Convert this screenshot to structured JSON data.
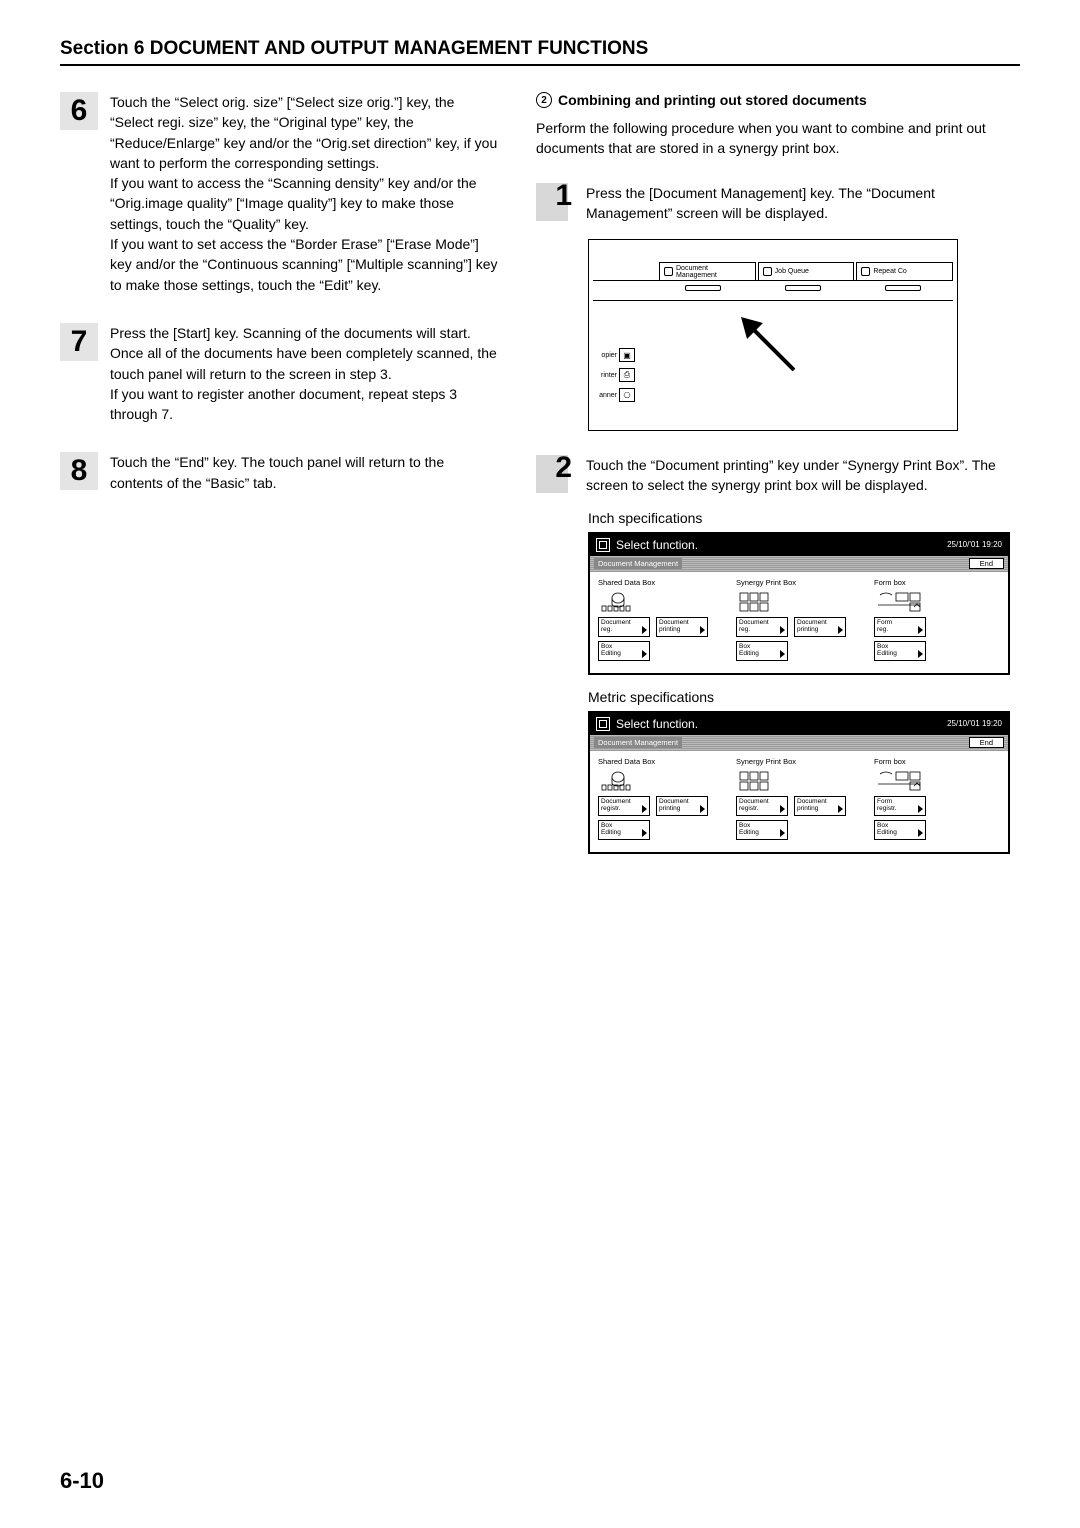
{
  "section_title": "Section 6  DOCUMENT AND OUTPUT MANAGEMENT FUNCTIONS",
  "left": {
    "steps": [
      {
        "num": "6",
        "paras": [
          "Touch the “Select orig. size” [“Select size orig.”] key, the “Select regi. size” key, the “Original type” key, the “Reduce/Enlarge” key and/or the “Orig.set direction” key, if you want to perform the corresponding settings.",
          "If you want to access the “Scanning density” key and/or the “Orig.image quality” [“Image quality”] key to make those settings, touch the “Quality” key.",
          "If you want to set access the “Border Erase” [“Erase Mode”] key and/or the “Continuous scanning” [“Multiple scanning”] key to make those settings, touch the “Edit” key."
        ]
      },
      {
        "num": "7",
        "paras": [
          "Press the [Start] key. Scanning of the documents will start. Once all of the documents have been completely scanned, the touch panel will return to the screen in step 3.",
          "If you want to register another document, repeat steps 3 through 7."
        ]
      },
      {
        "num": "8",
        "paras": [
          "Touch the “End” key. The touch panel will return to the contents of the “Basic” tab."
        ]
      }
    ]
  },
  "right": {
    "sub_number": "2",
    "sub_title": "Combining and printing out stored documents",
    "intro": "Perform the following procedure when you want to combine and print out documents that are stored in a synergy print box.",
    "steps": [
      {
        "num": "1",
        "text": "Press the [Document Management] key. The “Document Management” screen will be displayed."
      },
      {
        "num": "2",
        "text": "Touch the “Document printing” key under “Synergy Print Box”. The screen to select the synergy print box will be displayed."
      }
    ],
    "illus": {
      "tabs": [
        {
          "icon": "▦",
          "label": "Document Management"
        },
        {
          "icon": "▷",
          "label": "Job Queue"
        },
        {
          "icon": "↻",
          "label": "Repeat Co"
        }
      ],
      "side": [
        {
          "label": "opier",
          "glyph": "▣"
        },
        {
          "label": "rinter",
          "glyph": "⎙"
        },
        {
          "label": "anner",
          "glyph": "⎔"
        }
      ]
    },
    "caption_inch": "Inch specifications",
    "caption_metric": "Metric specifications",
    "panel_common": {
      "title": "Select function.",
      "timestamp1": "25/10/'01 19:20",
      "timestamp2": "25/10/'01   19:20",
      "strip_label": "Document Management",
      "strip_end": "End",
      "cols": [
        {
          "hdr": "Shared Data Box",
          "btns_row1_a": "Document",
          "btns_row1_b": "Document",
          "btns_row2": "Box"
        },
        {
          "hdr": "Synergy Print Box",
          "btns_row1_a": "Document",
          "btns_row1_b": "Document",
          "btns_row2": "Box"
        },
        {
          "hdr": "Form box",
          "btns_row1_a": "Form",
          "btns_row2": "Box"
        }
      ]
    },
    "panel_inch": {
      "row1_suffix_a": "reg.",
      "row1_suffix_b": "printing",
      "row2_suffix": "Editing",
      "form_suffix": "reg."
    },
    "panel_metric": {
      "row1_suffix_a": "registr.",
      "row1_suffix_b": "printing",
      "row2_suffix": "Editing",
      "form_suffix": "registr."
    }
  },
  "page_number": "6-10"
}
